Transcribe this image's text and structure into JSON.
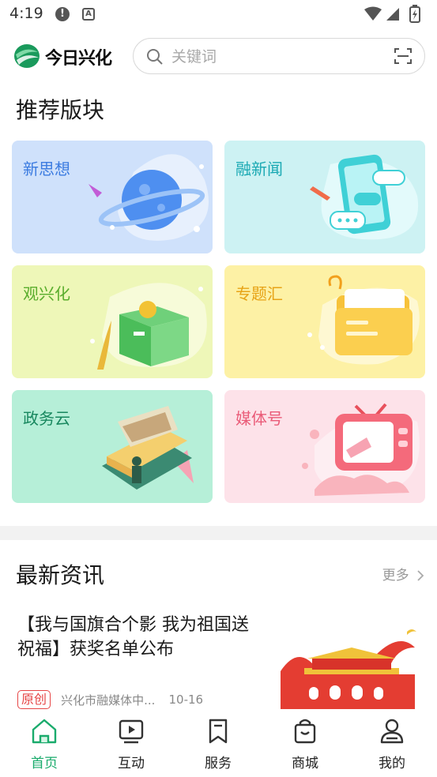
{
  "status_bar": {
    "time": "4:19",
    "alert_glyph": "!",
    "notif_glyph": "A"
  },
  "header": {
    "logo_text": "今日兴化"
  },
  "search": {
    "placeholder": "关键词"
  },
  "recommend": {
    "title": "推荐版块",
    "tiles": [
      {
        "label": "新思想",
        "color": "#3b7be0",
        "bg": "#cfe1fb"
      },
      {
        "label": "融新闻",
        "color": "#1aa9b3",
        "bg": "#cdf2f3"
      },
      {
        "label": "观兴化",
        "color": "#59ad2c",
        "bg": "#eef7b8"
      },
      {
        "label": "专题汇",
        "color": "#e7a316",
        "bg": "#fdf1a5"
      },
      {
        "label": "政务云",
        "color": "#17875e",
        "bg": "#b6efd8"
      },
      {
        "label": "媒体号",
        "color": "#ea5b78",
        "bg": "#fde2e9"
      }
    ]
  },
  "news": {
    "title": "最新资讯",
    "more": "更多",
    "items": [
      {
        "headline": "【我与国旗合个影 我为祖国送祝福】获奖名单公布",
        "badge": "原创",
        "source": "兴化市融媒体中...",
        "date": "10-16"
      }
    ]
  },
  "nav": {
    "items": [
      {
        "label": "首页",
        "icon": "home-icon",
        "active": true
      },
      {
        "label": "互动",
        "icon": "video-icon",
        "active": false
      },
      {
        "label": "服务",
        "icon": "bookmark-icon",
        "active": false
      },
      {
        "label": "商城",
        "icon": "shopping-bag-icon",
        "active": false
      },
      {
        "label": "我的",
        "icon": "user-icon",
        "active": false
      }
    ],
    "active_color": "#1aab6c"
  }
}
